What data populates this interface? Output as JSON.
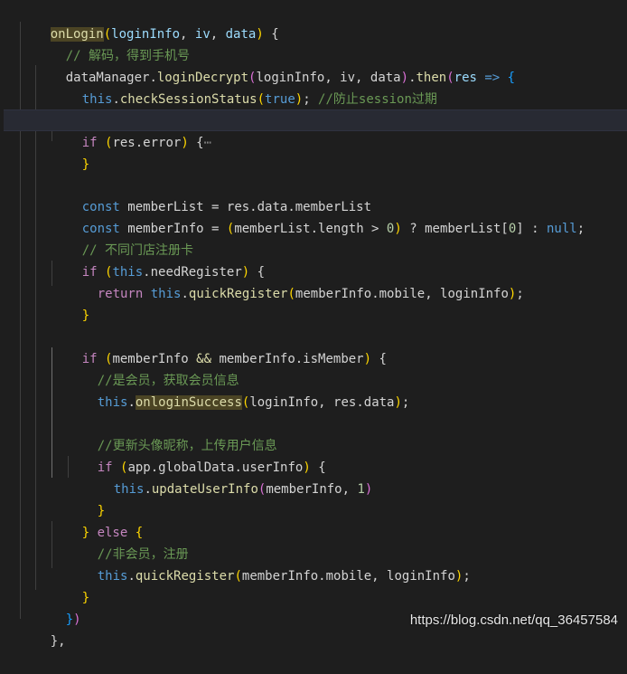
{
  "editor": {
    "theme_background": "#1e1e1e",
    "accent_function": "#dcdcaa",
    "accent_keyword": "#569cd6",
    "accent_comment": "#6a9955",
    "accent_control": "#c586c0"
  },
  "code": {
    "l1": {
      "fn": "onLogin",
      "p": "(",
      "a1": "loginInfo",
      "c1": ",",
      "a2": " iv",
      "c2": ",",
      "a3": " data",
      "pe": ")",
      "brace": " {"
    },
    "l2": {
      "comment": "// 解码，得到手机号"
    },
    "l3": {
      "obj": "dataManager",
      "dot": ".",
      "fn": "loginDecrypt",
      "p": "(",
      "args": "loginInfo, iv, data",
      "pe": ")",
      "dot2": ".",
      "fn2": "then",
      "p2": "(",
      "param": "res",
      "arrow": " => ",
      "brace": "{"
    },
    "l4": {
      "this": "this",
      "dot": ".",
      "fn": "checkSessionStatus",
      "p": "(",
      "val": "true",
      "pe": ")",
      "semi": "; ",
      "comment": "//防止session过期"
    },
    "l6": {
      "kw": "if",
      "sp": " ",
      "p": "(",
      "expr": "res.error",
      "pe": ")",
      "brace": " {",
      "fold": "⋯"
    },
    "l7": {
      "brace": "}"
    },
    "l9": {
      "kw": "const",
      "name": " memberList",
      "eq": " = ",
      "expr": "res.data.memberList"
    },
    "l10": {
      "kw": "const",
      "name": " memberInfo",
      "eq": " = ",
      "p": "(",
      "expr": "memberList.length",
      "gt": " > ",
      "num": "0",
      "pe": ")",
      "q": " ? ",
      "idx": "memberList[",
      "num2": "0",
      "idxe": "]",
      "colon": " : ",
      "nul": "null",
      "semi": ";"
    },
    "l11": {
      "comment": "// 不同门店注册卡"
    },
    "l12": {
      "kw": "if",
      "sp": " ",
      "p": "(",
      "this": "this",
      "expr": ".needRegister",
      "pe": ")",
      "brace": " {"
    },
    "l13": {
      "kw": "return",
      "this": " this",
      "dot": ".",
      "fn": "quickRegister",
      "p": "(",
      "args": "memberInfo.mobile, loginInfo",
      "pe": ")",
      "semi": ";"
    },
    "l14": {
      "brace": "}"
    },
    "l16": {
      "kw": "if",
      "sp": " ",
      "p": "(",
      "expr": "memberInfo ",
      "and": "&&",
      "expr2": " memberInfo.isMember",
      "pe": ")",
      "brace": " {"
    },
    "l17": {
      "comment": "//是会员，获取会员信息"
    },
    "l18": {
      "this": "this",
      "dot": ".",
      "fn": "onloginSuccess",
      "p": "(",
      "args": "loginInfo, res.data",
      "pe": ")",
      "semi": ";"
    },
    "l20": {
      "comment": "//更新头像昵称，上传用户信息"
    },
    "l21": {
      "kw": "if",
      "sp": " ",
      "p": "(",
      "expr": "app.globalData.userInfo",
      "pe": ")",
      "brace": " {"
    },
    "l22": {
      "this": "this",
      "dot": ".",
      "fn": "updateUserInfo",
      "p": "(",
      "args": "memberInfo, ",
      "num": "1",
      "pe": ")"
    },
    "l23": {
      "brace": "}"
    },
    "l24": {
      "brace": "} ",
      "kw": "else",
      "brace2": " {"
    },
    "l25": {
      "comment": "//非会员，注册"
    },
    "l26": {
      "this": "this",
      "dot": ".",
      "fn": "quickRegister",
      "p": "(",
      "args": "memberInfo.mobile, loginInfo",
      "pe": ")",
      "semi": ";"
    },
    "l27": {
      "brace": "}"
    },
    "l28": {
      "brace": "}",
      "pe": ")"
    },
    "l29": {
      "brace": "},"
    }
  },
  "watermark": {
    "text": "https://blog.csdn.net/qq_36457584"
  }
}
